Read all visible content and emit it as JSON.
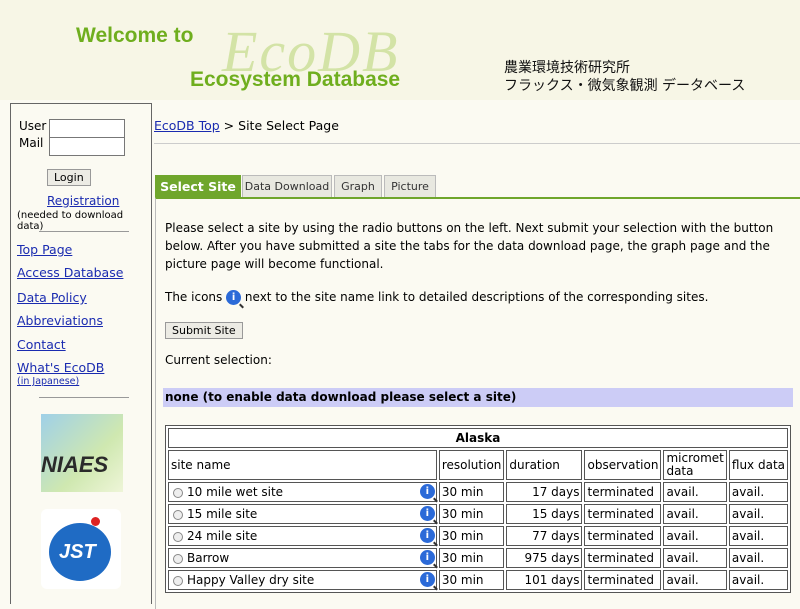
{
  "header": {
    "welcome": "Welcome to",
    "logo_text": "EcoDB",
    "subtitle": "Ecosystem Database",
    "jp_line1": "農業環境技術研究所",
    "jp_line2": "フラックス・微気象観測 データベース"
  },
  "login": {
    "user_label": "User",
    "mail_label": "Mail",
    "user_value": "",
    "mail_value": "",
    "login_button": "Login",
    "registration_link": "Registration",
    "registration_note": "(needed to download data)"
  },
  "nav": {
    "items": [
      "Top Page",
      "Access Database",
      "Data Policy",
      "Abbreviations",
      "Contact",
      "What's EcoDB"
    ],
    "jp_note": "(in Japanese)",
    "logo1": "NIAES",
    "logo2": "JST"
  },
  "breadcrumb": {
    "home": "EcoDB Top",
    "separator": ">",
    "current": "Site Select Page"
  },
  "tabs": [
    {
      "label": "Select Site",
      "active": true
    },
    {
      "label": "Data Download",
      "active": false
    },
    {
      "label": "Graph",
      "active": false
    },
    {
      "label": "Picture",
      "active": false
    }
  ],
  "main": {
    "description": "Please select a site by using the radio buttons on the left. Next submit your selection with the button below. After you have submitted a site the tabs for the data download page, the graph page and the picture page will become functional.",
    "icons_prefix": "The icons",
    "icons_suffix": "next to the site name link to detailed descriptions of the corresponding sites.",
    "submit_button": "Submit Site",
    "current_label": "Current selection:",
    "current_value": "none (to enable data download please select a site)"
  },
  "table": {
    "region": "Alaska",
    "columns": [
      "site name",
      "resolution",
      "duration",
      "observation",
      "micromet data",
      "flux data"
    ],
    "rows": [
      {
        "site": "10 mile wet site",
        "resolution": "30 min",
        "duration": "17 days",
        "observation": "terminated",
        "micromet": "avail.",
        "flux": "avail."
      },
      {
        "site": "15 mile site",
        "resolution": "30 min",
        "duration": "15 days",
        "observation": "terminated",
        "micromet": "avail.",
        "flux": "avail."
      },
      {
        "site": "24 mile site",
        "resolution": "30 min",
        "duration": "77 days",
        "observation": "terminated",
        "micromet": "avail.",
        "flux": "avail."
      },
      {
        "site": "Barrow",
        "resolution": "30 min",
        "duration": "975 days",
        "observation": "terminated",
        "micromet": "avail.",
        "flux": "avail."
      },
      {
        "site": "Happy Valley dry site",
        "resolution": "30 min",
        "duration": "101 days",
        "observation": "terminated",
        "micromet": "avail.",
        "flux": "avail."
      }
    ]
  },
  "colors": {
    "accent_green": "#6fae1e",
    "tab_active": "#6fa62c",
    "selection_bar": "#ccccf6",
    "link": "#1a2bb0"
  }
}
